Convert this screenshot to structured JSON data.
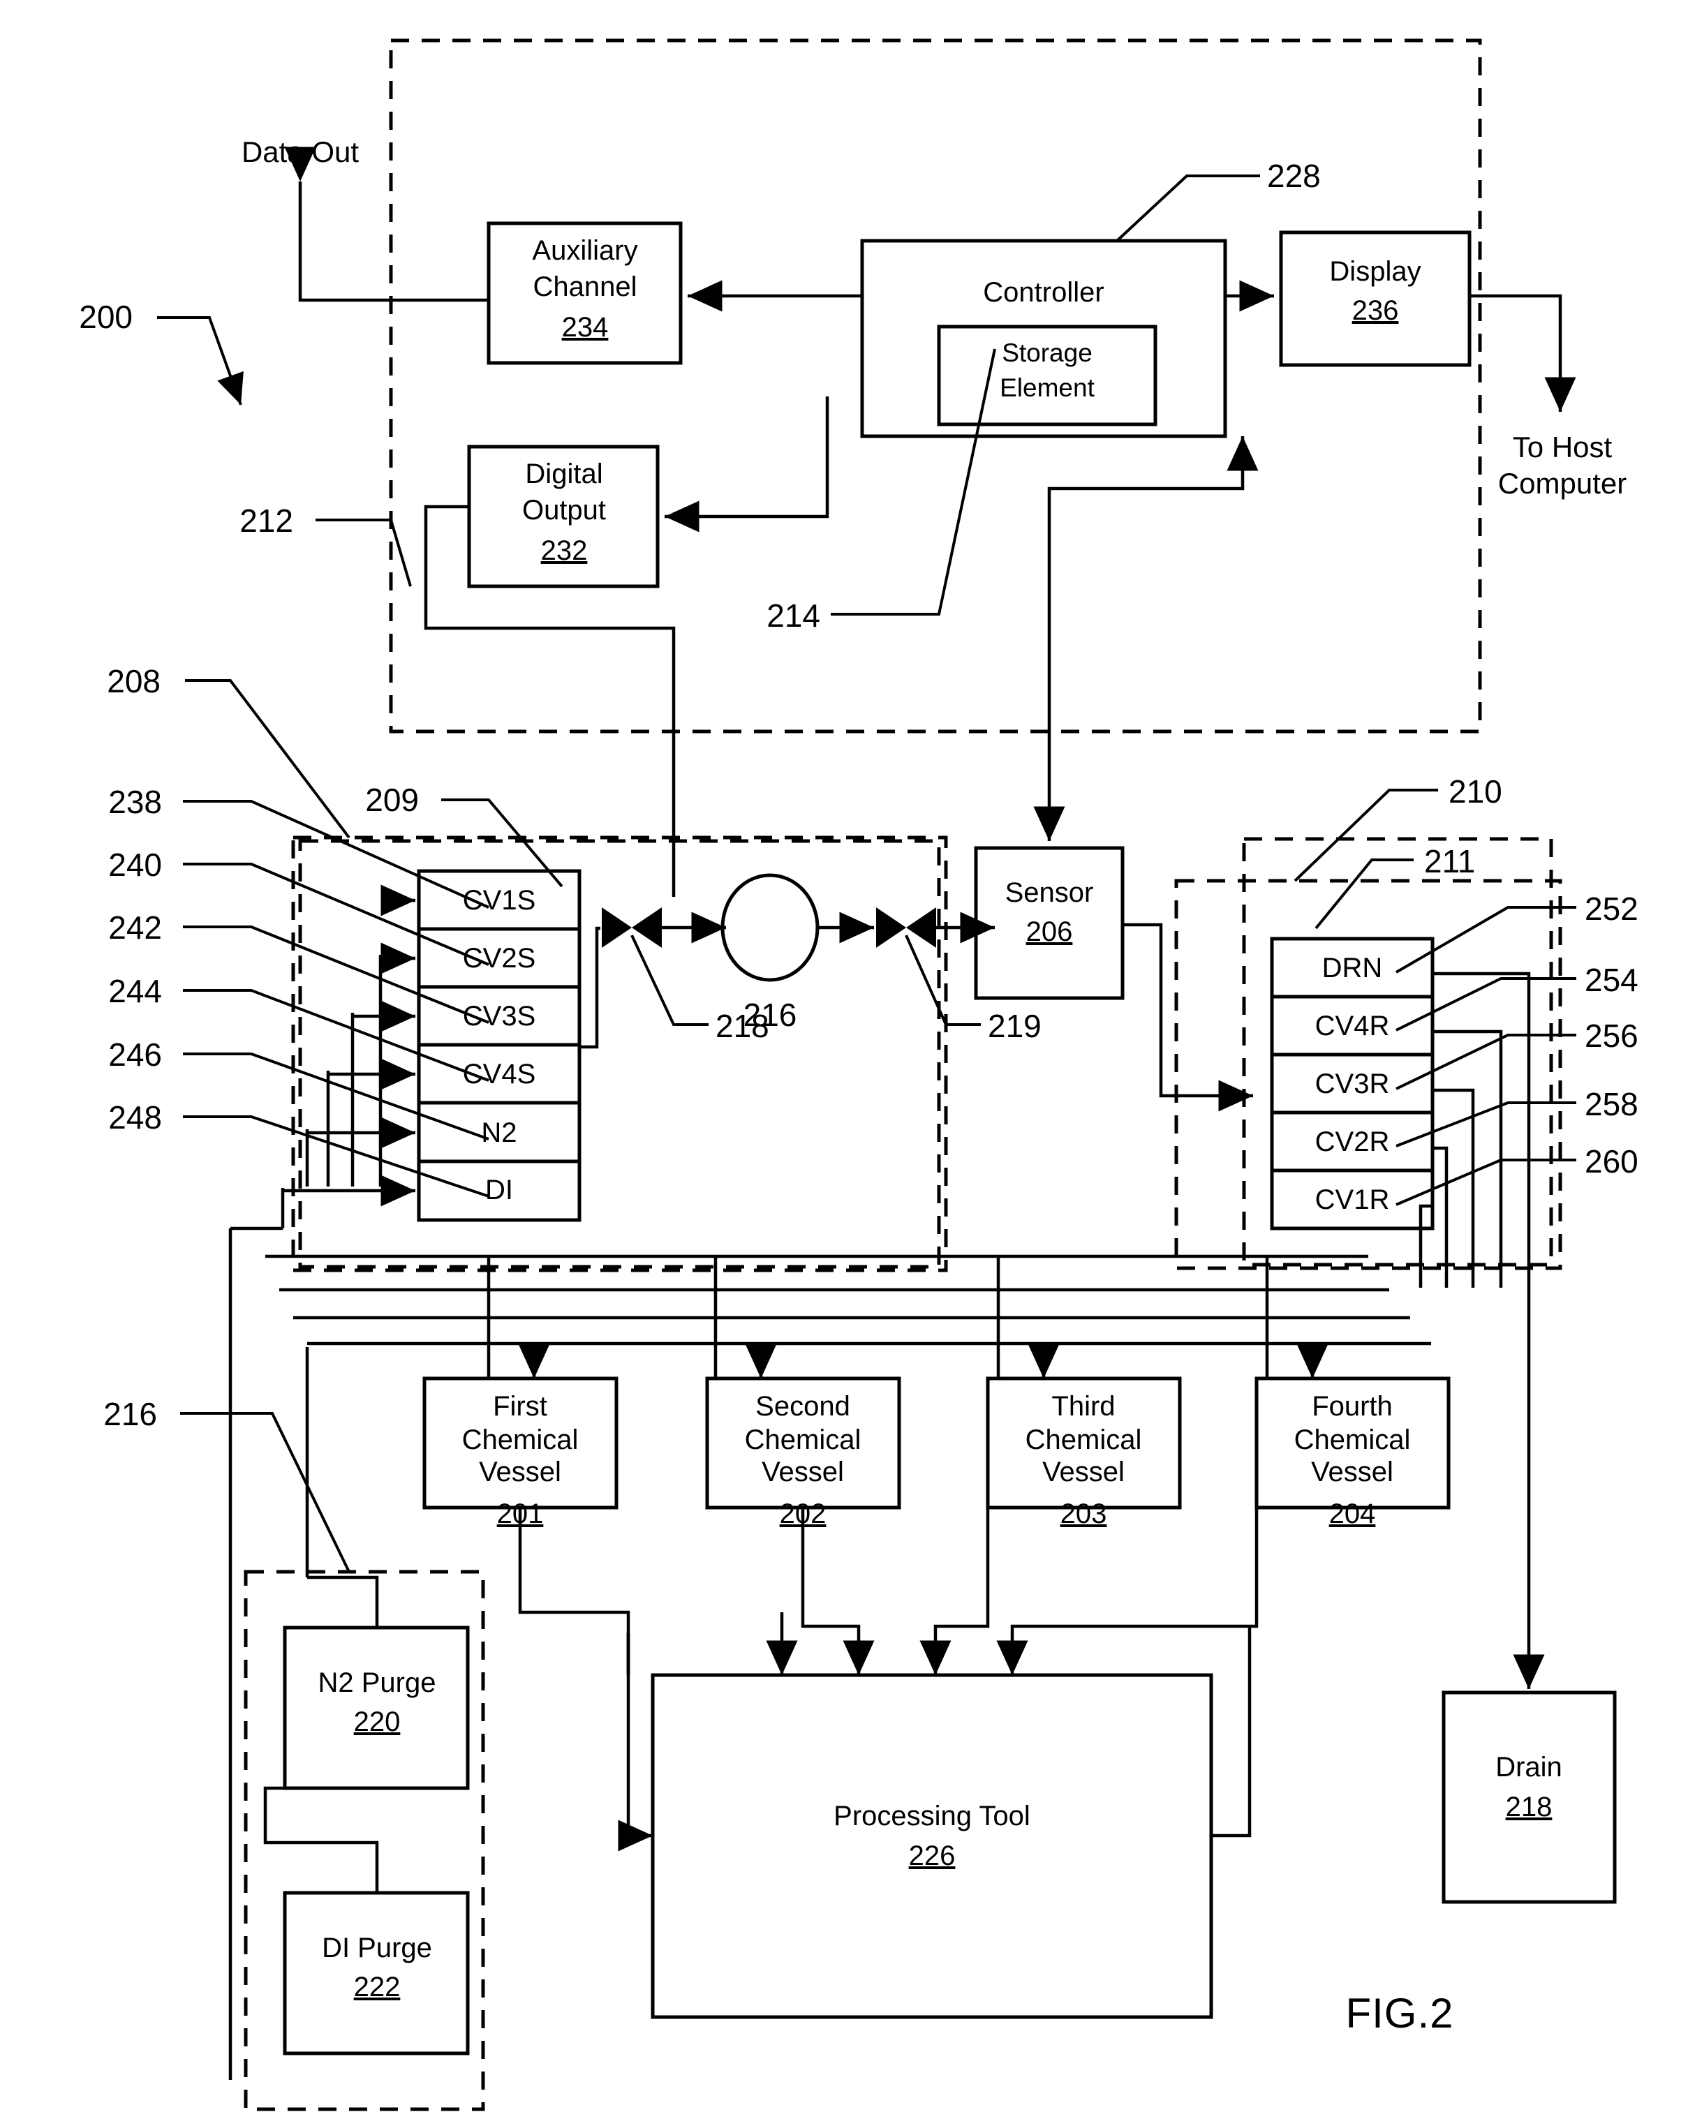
{
  "figure": {
    "name": "FIG.2",
    "overall_ref": "200"
  },
  "boundaries": [
    {
      "ref": "212",
      "name": "control-subsystem-boundary"
    },
    {
      "ref": "208",
      "name": "supply-manifold-boundary"
    },
    {
      "ref": "209",
      "name": "supply-valve-bank-boundary"
    },
    {
      "ref": "210",
      "name": "return-manifold-boundary"
    },
    {
      "ref": "211",
      "name": "return-valve-bank-boundary"
    },
    {
      "ref": "216",
      "name": "purge-subsystem-boundary"
    }
  ],
  "free_labels": {
    "data_out": "Data Out",
    "to_host_computer_line1": "To Host",
    "to_host_computer_line2": "Computer"
  },
  "blocks": [
    {
      "id": "auxiliary_channel",
      "lines": [
        "Auxiliary",
        "Channel"
      ],
      "ref": "234"
    },
    {
      "id": "controller",
      "lines": [
        "Controller"
      ],
      "ref": "228"
    },
    {
      "id": "storage_element",
      "lines": [
        "Storage",
        "Element"
      ],
      "ref": "214"
    },
    {
      "id": "display",
      "lines": [
        "Display"
      ],
      "ref": "236"
    },
    {
      "id": "digital_output",
      "lines": [
        "Digital",
        "Output"
      ],
      "ref": "232"
    },
    {
      "id": "sensor",
      "lines": [
        "Sensor"
      ],
      "ref": "206"
    },
    {
      "id": "first_chemical_vessel",
      "lines": [
        "First",
        "Chemical",
        "Vessel"
      ],
      "ref": "201"
    },
    {
      "id": "second_chemical_vessel",
      "lines": [
        "Second",
        "Chemical",
        "Vessel"
      ],
      "ref": "202"
    },
    {
      "id": "third_chemical_vessel",
      "lines": [
        "Third",
        "Chemical",
        "Vessel"
      ],
      "ref": "203"
    },
    {
      "id": "fourth_chemical_vessel",
      "lines": [
        "Fourth",
        "Chemical",
        "Vessel"
      ],
      "ref": "204"
    },
    {
      "id": "n2_purge",
      "lines": [
        "N2 Purge"
      ],
      "ref": "220"
    },
    {
      "id": "di_purge",
      "lines": [
        "DI Purge"
      ],
      "ref": "222"
    },
    {
      "id": "processing_tool",
      "lines": [
        "Processing Tool"
      ],
      "ref": "226"
    },
    {
      "id": "drain",
      "lines": [
        "Drain"
      ],
      "ref": "218"
    }
  ],
  "supply_valves": [
    {
      "label": "CV1S",
      "ref": "238"
    },
    {
      "label": "CV2S",
      "ref": "240"
    },
    {
      "label": "CV3S",
      "ref": "242"
    },
    {
      "label": "CV4S",
      "ref": "244"
    },
    {
      "label": "N2",
      "ref": "246"
    },
    {
      "label": "DI",
      "ref": "248"
    }
  ],
  "return_valves": [
    {
      "label": "DRN",
      "ref": "252"
    },
    {
      "label": "CV4R",
      "ref": "254"
    },
    {
      "label": "CV3R",
      "ref": "256"
    },
    {
      "label": "CV2R",
      "ref": "258"
    },
    {
      "label": "CV1R",
      "ref": "260"
    }
  ],
  "inline_refs": {
    "pump_or_mixer": "216",
    "valve_upstream": "218",
    "valve_downstream": "219"
  },
  "colors": {
    "ink": "#000000",
    "paper": "#ffffff"
  }
}
